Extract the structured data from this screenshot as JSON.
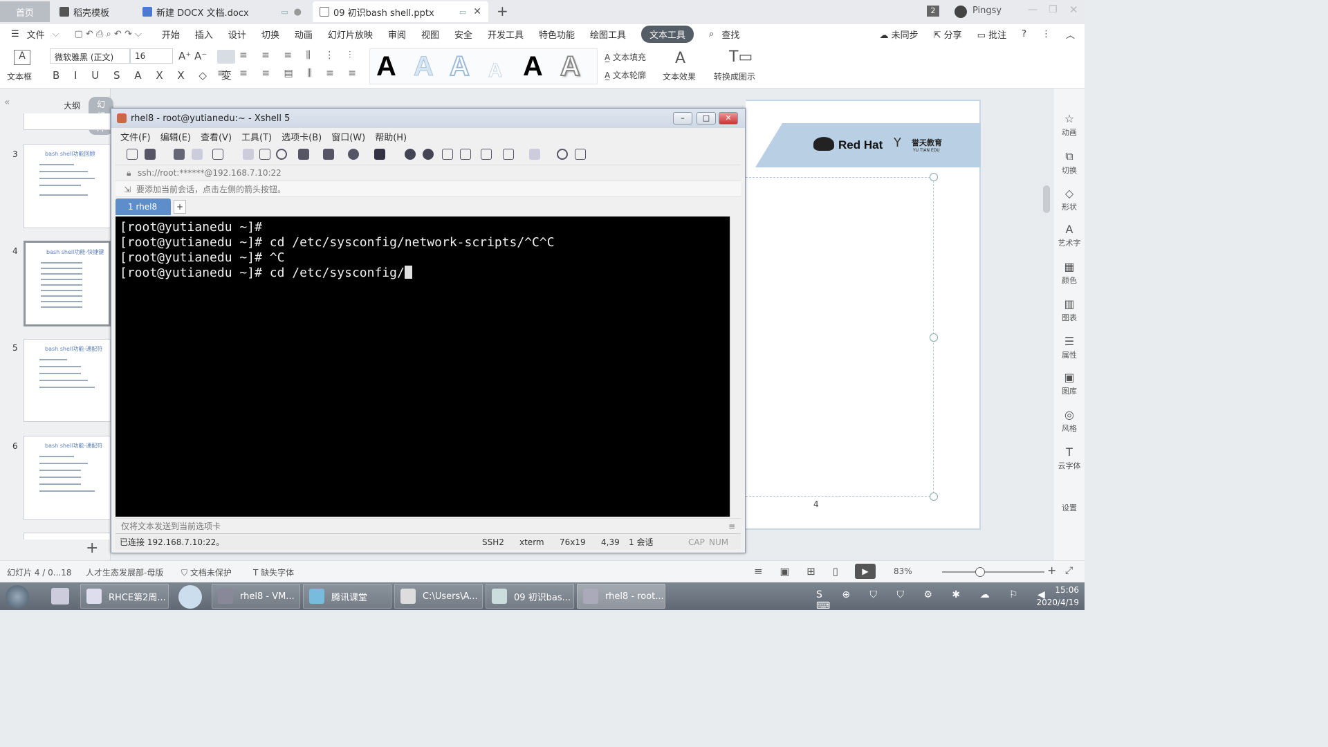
{
  "tabs": {
    "home": "首页",
    "items": [
      {
        "label": "稻壳模板"
      },
      {
        "label": "新建 DOCX 文档.docx"
      },
      {
        "label": "09 初识bash shell.pptx"
      }
    ],
    "count_badge": "2",
    "user": "Pingsy"
  },
  "menu": {
    "file": "文件",
    "items": [
      "开始",
      "插入",
      "设计",
      "切换",
      "动画",
      "幻灯片放映",
      "审阅",
      "视图",
      "安全",
      "开发工具",
      "特色功能",
      "绘图工具",
      "文本工具"
    ],
    "search": "查找",
    "sync": "未同步",
    "share": "分享",
    "comment": "批注"
  },
  "ribbon": {
    "textbox": "文本框",
    "font": "微软雅黑 (正文)",
    "size": "16",
    "text_fill": "文本填充",
    "text_outline": "文本轮廓",
    "text_effect": "文本效果",
    "to_shape": "转换成图示"
  },
  "left_panel": {
    "outline_tab": "大纲",
    "slides_tab": "幻灯片",
    "slides": [
      {
        "num": "3",
        "title": "bash shell功能回顾"
      },
      {
        "num": "4",
        "title": "bash shell功能-快捷键"
      },
      {
        "num": "5",
        "title": "bash shell功能-通配符"
      },
      {
        "num": "6",
        "title": "bash shell功能-通配符"
      }
    ]
  },
  "slide": {
    "brand": "Red Hat",
    "partner": "誉天教育",
    "partner_en": "YU TIAN EDU",
    "page_number": "4"
  },
  "right_panel": [
    "动画",
    "切换",
    "形状",
    "艺术字",
    "颜色",
    "图表",
    "属性",
    "图库",
    "风格",
    "云字体",
    "设置"
  ],
  "xshell": {
    "title": "rhel8 - root@yutianedu:~ - Xshell 5",
    "menu": [
      "文件(F)",
      "编辑(E)",
      "查看(V)",
      "工具(T)",
      "选项卡(B)",
      "窗口(W)",
      "帮助(H)"
    ],
    "address": "ssh://root:******@192.168.7.10:22",
    "hint": "要添加当前会话，点击左侧的箭头按钮。",
    "session_tab": "1 rhel8",
    "terminal_lines": [
      "[root@yutianedu ~]#",
      "[root@yutianedu ~]# cd /etc/sysconfig/network-scripts/^C^C",
      "[root@yutianedu ~]# ^C",
      "[root@yutianedu ~]# cd /etc/sysconfig/"
    ],
    "send_bar": "仅将文本发送到当前选项卡",
    "status": {
      "connected": "已连接 192.168.7.10:22。",
      "protocol": "SSH2",
      "term": "xterm",
      "size": "76x19",
      "cursor": "4,39",
      "sessions": "1 会话",
      "cap": "CAP",
      "num": "NUM"
    }
  },
  "statusbar": {
    "slide_info": "幻灯片 4 / 0...18",
    "template": "人才生态发展部-母版",
    "protect": "文档未保护",
    "missing_font": "缺失字体",
    "zoom": "83%"
  },
  "taskbar": {
    "items": [
      "RHCE第2周...",
      "rhel8 - VM...",
      "腾讯课堂",
      "C:\\Users\\A...",
      "09 初识bas...",
      "rhel8 - root..."
    ],
    "time": "15:06",
    "date": "2020/4/19"
  },
  "colors": {
    "terminal_bg": "#000000",
    "terminal_fg": "#f0f0f0",
    "accent_blue": "#5d8ec9",
    "slide_banner": "#b9cfe3"
  }
}
